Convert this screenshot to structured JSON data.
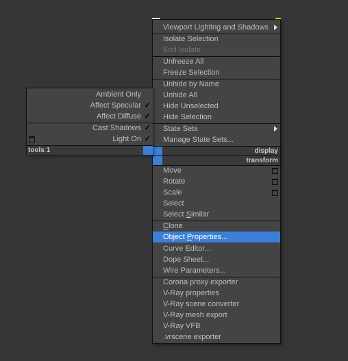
{
  "right_menu": {
    "groups": [
      [
        {
          "label": "Viewport Lighting and Shadows",
          "submenu": true,
          "disabled": false
        }
      ],
      [
        {
          "label": "Isolate Selection",
          "disabled": false
        },
        {
          "label": "End Isolate",
          "disabled": true
        }
      ],
      [
        {
          "label": "Unfreeze All",
          "disabled": false
        },
        {
          "label": "Freeze Selection",
          "disabled": false
        }
      ],
      [
        {
          "label": "Unhide by Name",
          "disabled": false
        },
        {
          "label": "Unhide All",
          "disabled": false
        },
        {
          "label": "Hide Unselected",
          "disabled": false
        },
        {
          "label": "Hide Selection",
          "disabled": false
        }
      ],
      [
        {
          "label": "State Sets",
          "submenu": true,
          "disabled": false
        },
        {
          "label": "Manage State Sets...",
          "disabled": false
        }
      ]
    ],
    "quad_titles": [
      "display",
      "transform"
    ],
    "transform_items": [
      {
        "label": "Move",
        "options_icon": true
      },
      {
        "label": "Rotate",
        "options_icon": true
      },
      {
        "label": "Scale",
        "options_icon": true
      },
      {
        "label": "Select",
        "options_icon": false
      },
      {
        "label": "Select Similar",
        "underline": "S",
        "underline_index": 7,
        "options_icon": false
      }
    ],
    "clone_group": [
      {
        "label": "Clone",
        "underline_index": 0
      },
      {
        "label": "Object Properties...",
        "underline_index": 7,
        "highlighted": true
      },
      {
        "label": "Curve Editor..."
      },
      {
        "label": "Dope Sheet..."
      },
      {
        "label": "Wire Parameters..."
      }
    ],
    "plugin_group": [
      {
        "label": "Corona proxy exporter"
      },
      {
        "label": "V-Ray properties"
      },
      {
        "label": "V-Ray scene converter"
      },
      {
        "label": "V-Ray mesh export"
      },
      {
        "label": "V-Ray VFB"
      },
      {
        "label": ".vrscene exporter"
      }
    ]
  },
  "left_menu": {
    "items": [
      {
        "label": "Ambient Only",
        "checked": false
      },
      {
        "label": "Affect Specular",
        "checked": true
      },
      {
        "label": "Affect Diffuse",
        "checked": true
      },
      {
        "label": "Cast Shadows",
        "checked": true
      },
      {
        "label": "Light On",
        "checked": true,
        "options_icon": true
      }
    ],
    "title": "tools 1"
  },
  "glyphs": {
    "check": "✓"
  },
  "colors": {
    "highlight": "#3c7fd8",
    "menu_bg": "#444444",
    "text": "#bdbdbd",
    "disabled_text": "#747474"
  }
}
